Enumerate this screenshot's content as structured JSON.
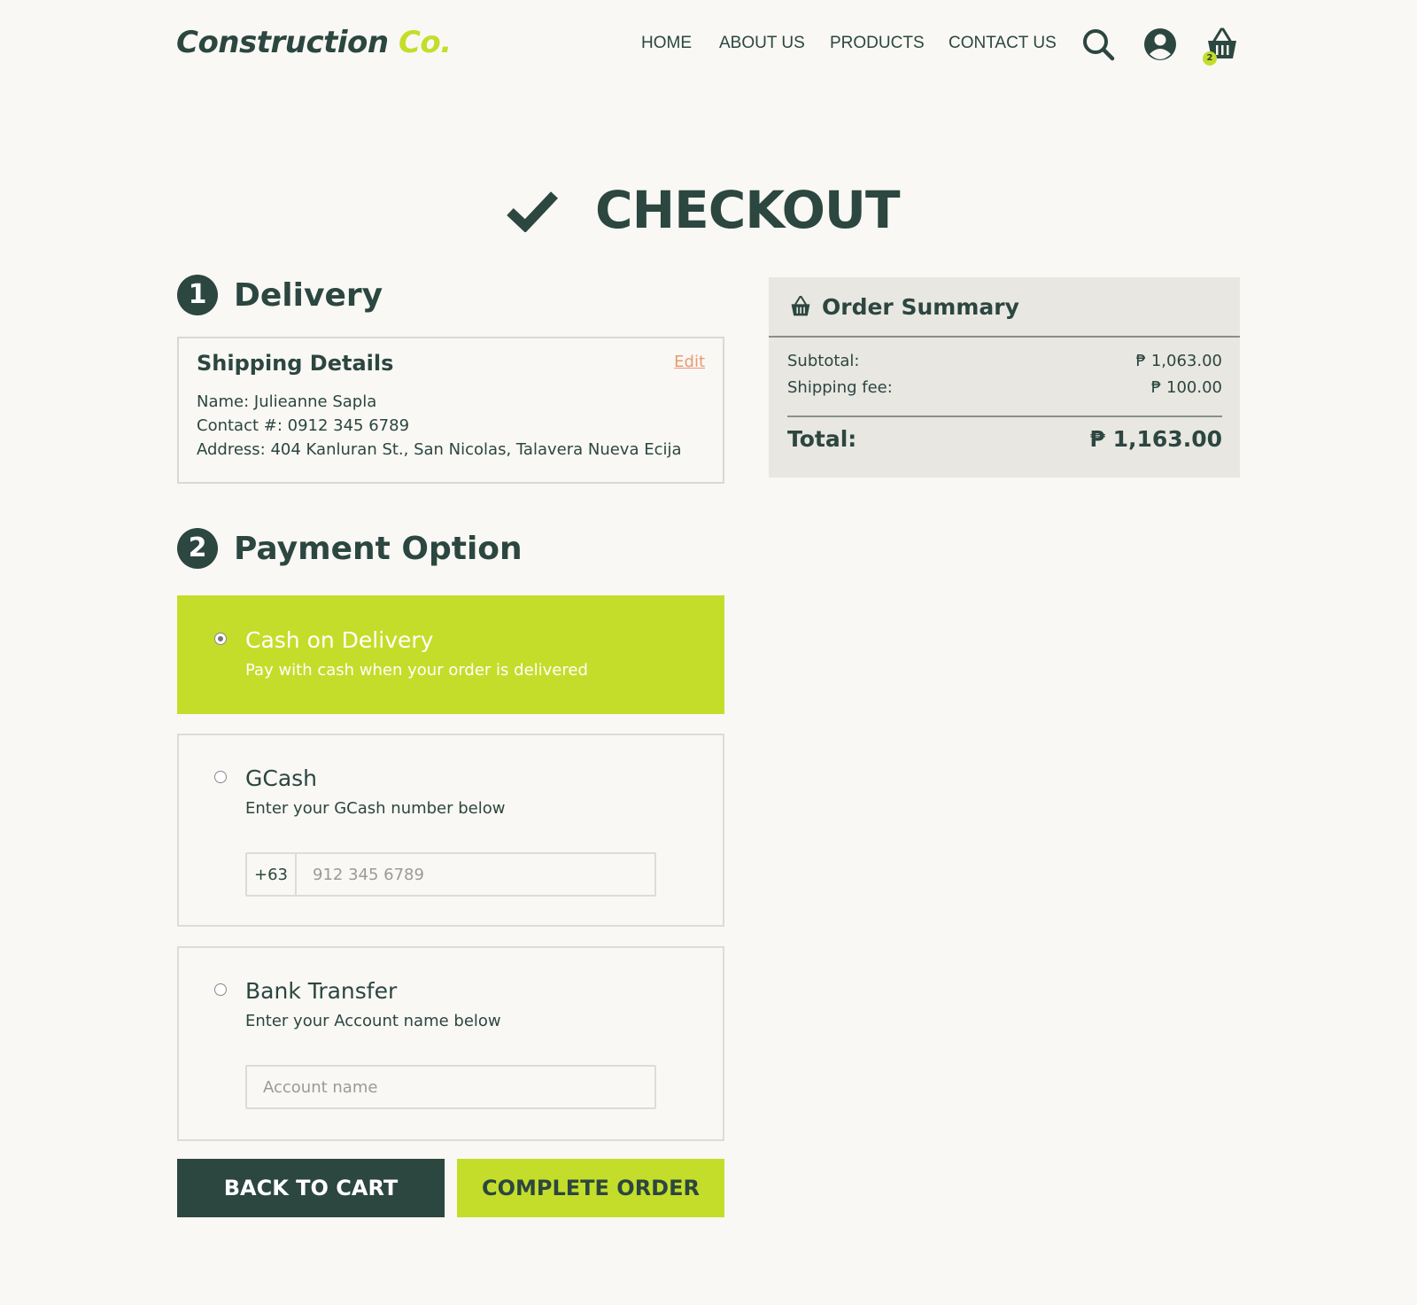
{
  "header": {
    "logo_main": "Construction",
    "logo_accent": "Co.",
    "nav": [
      "HOME",
      "ABOUT US",
      "PRODUCTS",
      "CONTACT US"
    ],
    "cart_count": "2",
    "icons": [
      "search-icon",
      "user-icon",
      "cart-icon"
    ]
  },
  "page": {
    "title": "CHECKOUT"
  },
  "delivery": {
    "step": "1",
    "heading": "Delivery",
    "card_title": "Shipping Details",
    "edit_label": "Edit",
    "name": "Name: Julieanne Sapla",
    "contact": "Contact #: 0912 345 6789",
    "address": "Address: 404 Kanluran St., San Nicolas, Talavera Nueva Ecija"
  },
  "payment": {
    "step": "2",
    "heading": "Payment Option",
    "options": [
      {
        "title": "Cash on Delivery",
        "subtitle": "Pay with cash when your order is delivered",
        "selected": true
      },
      {
        "title": "GCash",
        "subtitle": "Enter your GCash number below",
        "prefix": "+63",
        "placeholder": "912 345 6789",
        "value": ""
      },
      {
        "title": "Bank Transfer",
        "subtitle": "Enter your Account name below",
        "placeholder": "Account name",
        "value": ""
      }
    ]
  },
  "buttons": {
    "back": "BACK TO CART",
    "complete": "COMPLETE ORDER"
  },
  "summary": {
    "title": "Order Summary",
    "subtotal_label": "Subtotal:",
    "subtotal_value": "₱ 1,063.00",
    "shipping_label": "Shipping fee:",
    "shipping_value": "₱ 100.00",
    "total_label": "Total:",
    "total_value": "₱ 1,163.00"
  },
  "colors": {
    "primary": "#2c4640",
    "accent": "#c4dd2a",
    "background": "#f9f8f5",
    "summary_bg": "#e9e7e2",
    "edit_link": "#e89a70"
  }
}
